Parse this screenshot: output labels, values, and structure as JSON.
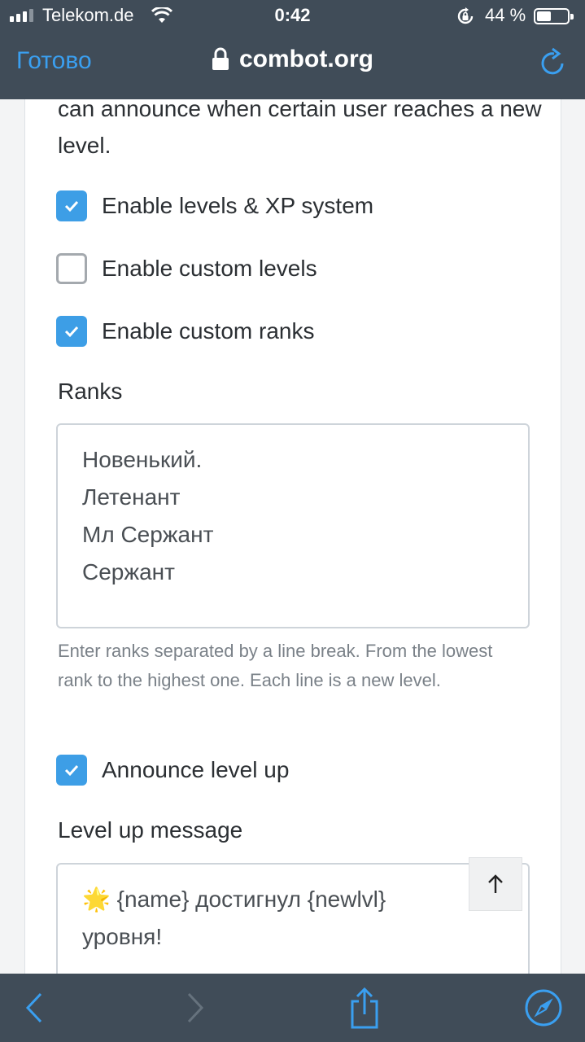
{
  "status_bar": {
    "carrier": "Telekom.de",
    "time": "0:42",
    "battery": "44 %",
    "battery_level": 0.44,
    "signal_bars": 3,
    "icons": [
      "signal-icon",
      "wifi-icon",
      "rotation-lock-icon",
      "battery-icon"
    ]
  },
  "browser": {
    "done_label": "Готово",
    "url": "combot.org",
    "icons": [
      "lock-icon",
      "reload-icon"
    ]
  },
  "settings": {
    "intro_text": "can announce when certain user reaches a new level.",
    "checkboxes": [
      {
        "label": "Enable levels & XP system",
        "checked": true
      },
      {
        "label": "Enable custom levels",
        "checked": false
      },
      {
        "label": "Enable custom ranks",
        "checked": true
      }
    ],
    "ranks": {
      "label": "Ranks",
      "lines": [
        "Новенький.",
        "Летенант",
        "Мл Сержант",
        "Сержант"
      ],
      "help": "Enter ranks separated by a line break. From the lowest rank to the highest one. Each line is a new level."
    },
    "announce": {
      "label": "Announce level up",
      "checked": true
    },
    "level_up_message": {
      "label": "Level up message",
      "line1_emoji": "🌟",
      "line1_text": "{name} достигнул {newlvl}",
      "line2": "уровня!"
    }
  },
  "colors": {
    "accent": "#3d9ee6",
    "header_bg": "#404c58",
    "link": "#3a9ff0"
  },
  "toolbar": {
    "icons": [
      "back-icon",
      "forward-icon",
      "share-icon",
      "compass-icon"
    ]
  }
}
